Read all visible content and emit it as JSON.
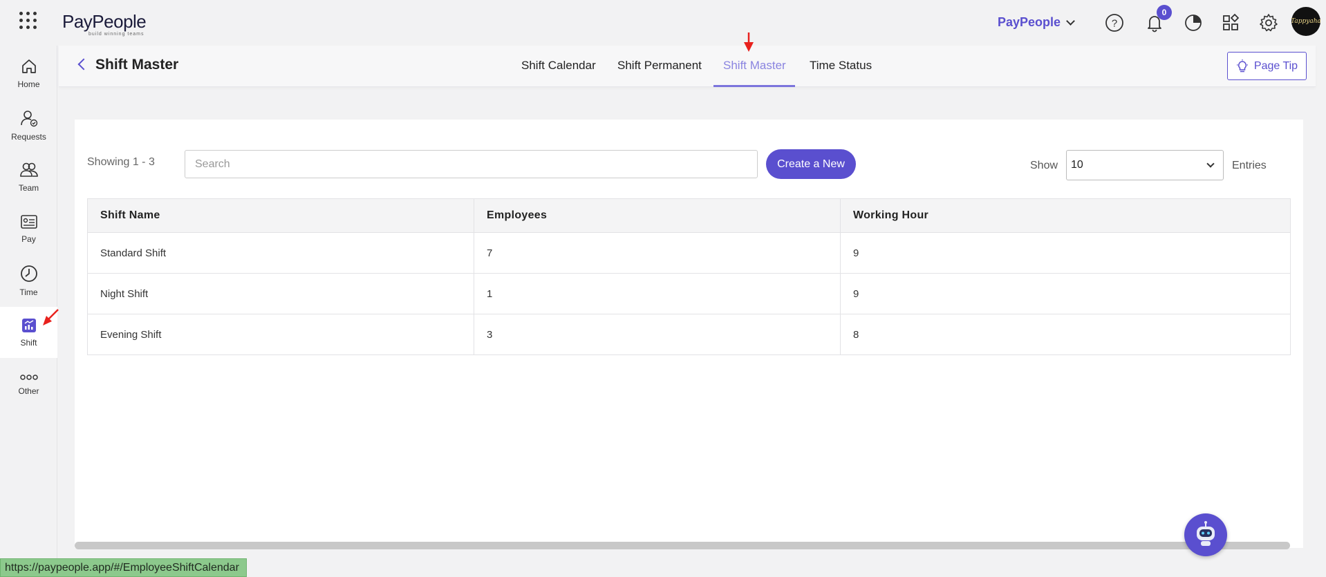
{
  "topbar": {
    "logo_text": "PayPeople",
    "logo_tagline": "build winning teams",
    "company_name": "PayPeople",
    "notification_count": "0",
    "avatar_text": "Tappyaha"
  },
  "sidebar": {
    "items": [
      {
        "label": "Home",
        "icon": "home-icon"
      },
      {
        "label": "Requests",
        "icon": "requests-icon"
      },
      {
        "label": "Team",
        "icon": "team-icon"
      },
      {
        "label": "Pay",
        "icon": "pay-icon"
      },
      {
        "label": "Time",
        "icon": "clock-icon"
      },
      {
        "label": "Shift",
        "icon": "shift-icon"
      },
      {
        "label": "Other",
        "icon": "more-icon"
      }
    ],
    "active": "Shift"
  },
  "header": {
    "title": "Shift Master",
    "tabs": [
      {
        "label": "Shift Calendar"
      },
      {
        "label": "Shift Permanent"
      },
      {
        "label": "Shift Master"
      },
      {
        "label": "Time Status"
      }
    ],
    "active_tab": "Shift Master",
    "page_tip_label": "Page Tip"
  },
  "main": {
    "showing_text": "Showing 1 - 3",
    "search_placeholder": "Search",
    "create_label": "Create a New",
    "show_label": "Show",
    "entries_value": "10",
    "entries_label": "Entries",
    "table": {
      "headers": [
        "Shift Name",
        "Employees",
        "Working Hour"
      ],
      "rows": [
        {
          "name": "Standard Shift",
          "employees": "7",
          "hours": "9"
        },
        {
          "name": "Night Shift",
          "employees": "1",
          "hours": "9"
        },
        {
          "name": "Evening Shift",
          "employees": "3",
          "hours": "8"
        }
      ]
    }
  },
  "status_url": "https://paypeople.app/#/EmployeeShiftCalendar",
  "colors": {
    "accent": "#5a4fcf",
    "tab_active": "#8a84e0",
    "annotation_arrow": "#e8211d"
  }
}
